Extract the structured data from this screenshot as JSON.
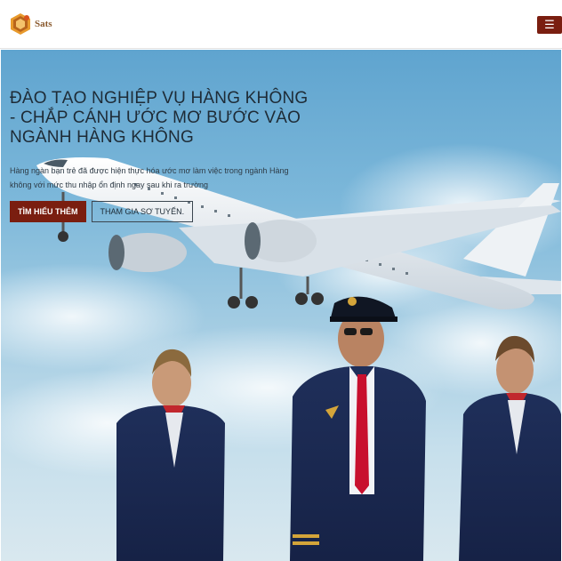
{
  "brand": {
    "name": "Sats",
    "logo_icon": "hexagon-logo-icon",
    "accent": "#7a1e10"
  },
  "header": {
    "menu_icon": "hamburger-icon",
    "menu_glyph": "☰"
  },
  "hero": {
    "title": "Đào tạo nghiệp vụ hàng không - Chắp cánh ước mơ bước vào ngành hàng không",
    "description": "Hàng ngàn bạn trẻ đã được hiện thực hóa ước mơ làm việc trong ngành Hàng không với mức thu nhập ổn định ngay sau khi ra trường",
    "primary_button": "Tìm hiểu thêm",
    "secondary_button": "Tham gia sơ tuyển."
  }
}
